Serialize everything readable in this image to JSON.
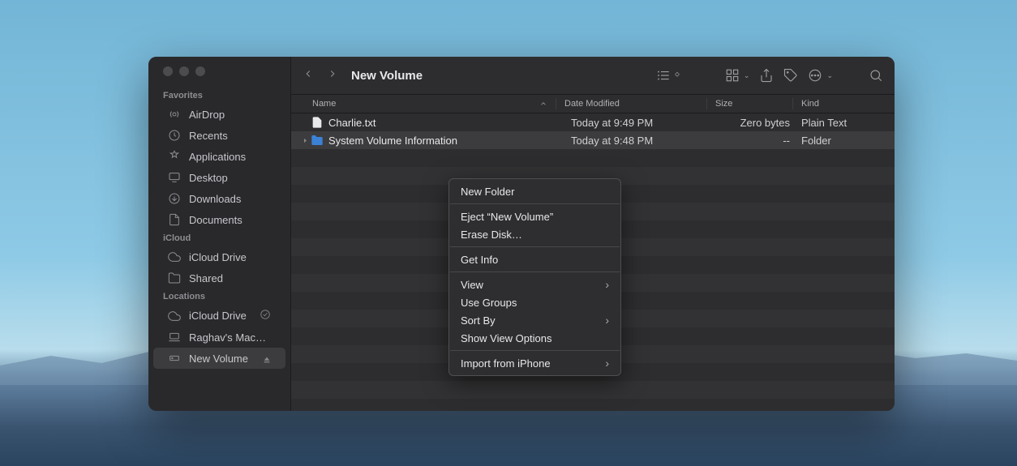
{
  "window_title": "New Volume",
  "sidebar": {
    "sections": [
      {
        "title": "Favorites",
        "items": [
          {
            "icon": "airdrop",
            "label": "AirDrop"
          },
          {
            "icon": "clock",
            "label": "Recents"
          },
          {
            "icon": "apps",
            "label": "Applications"
          },
          {
            "icon": "desktop",
            "label": "Desktop"
          },
          {
            "icon": "download",
            "label": "Downloads"
          },
          {
            "icon": "doc",
            "label": "Documents"
          }
        ]
      },
      {
        "title": "iCloud",
        "items": [
          {
            "icon": "cloud",
            "label": "iCloud Drive"
          },
          {
            "icon": "shared",
            "label": "Shared"
          }
        ]
      },
      {
        "title": "Locations",
        "items": [
          {
            "icon": "cloud",
            "label": "iCloud Drive",
            "check": true
          },
          {
            "icon": "laptop",
            "label": "Raghav's Mac…"
          },
          {
            "icon": "disk",
            "label": "New Volume",
            "selected": true,
            "eject": true
          }
        ]
      }
    ]
  },
  "columns": {
    "name": "Name",
    "date": "Date Modified",
    "size": "Size",
    "kind": "Kind"
  },
  "files": [
    {
      "icon": "file",
      "name": "Charlie.txt",
      "date": "Today at 9:49 PM",
      "size": "Zero bytes",
      "kind": "Plain Text",
      "disc": false
    },
    {
      "icon": "folder",
      "name": "System Volume Information",
      "date": "Today at 9:48 PM",
      "size": "--",
      "kind": "Folder",
      "disc": true,
      "selected": true
    }
  ],
  "context_menu": [
    {
      "label": "New Folder"
    },
    {
      "sep": true
    },
    {
      "label": "Eject “New Volume”"
    },
    {
      "label": "Erase Disk…"
    },
    {
      "sep": true
    },
    {
      "label": "Get Info"
    },
    {
      "sep": true
    },
    {
      "label": "View",
      "sub": true
    },
    {
      "label": "Use Groups"
    },
    {
      "label": "Sort By",
      "sub": true
    },
    {
      "label": "Show View Options"
    },
    {
      "sep": true
    },
    {
      "label": "Import from iPhone",
      "sub": true
    }
  ]
}
